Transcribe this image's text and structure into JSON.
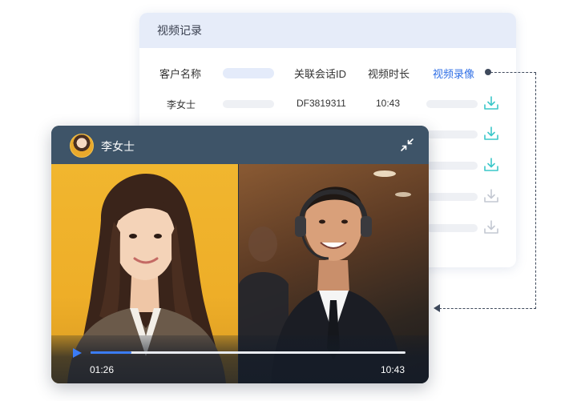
{
  "records": {
    "title": "视频记录",
    "columns": {
      "customer_name": "客户名称",
      "session_id": "关联会话ID",
      "duration": "视频时长",
      "recording": "视频录像"
    },
    "rows": [
      {
        "name": "李女士",
        "session_id": "DF3819311",
        "duration": "10:43",
        "download_active": true
      },
      {
        "name": "",
        "session_id": "",
        "duration": "",
        "download_active": true
      },
      {
        "name": "",
        "session_id": "",
        "duration": "",
        "download_active": true
      },
      {
        "name": "",
        "session_id": "",
        "duration": "",
        "download_active": false
      },
      {
        "name": "",
        "session_id": "",
        "duration": "",
        "download_active": false
      }
    ],
    "colors": {
      "accent": "#2f6fe6",
      "download_active": "#3cc7c9",
      "download_inactive": "#c3c8d2"
    }
  },
  "video_call": {
    "caller_name": "李女士",
    "current_time": "01:26",
    "total_time": "10:43",
    "progress": 0.13,
    "colors": {
      "titlebar": "#3e5468",
      "progress": "#3b7cf5"
    }
  },
  "icons": {
    "avatar": "avatar",
    "minimize": "minimize-arrows-icon",
    "play": "play-icon",
    "download": "download-icon"
  }
}
